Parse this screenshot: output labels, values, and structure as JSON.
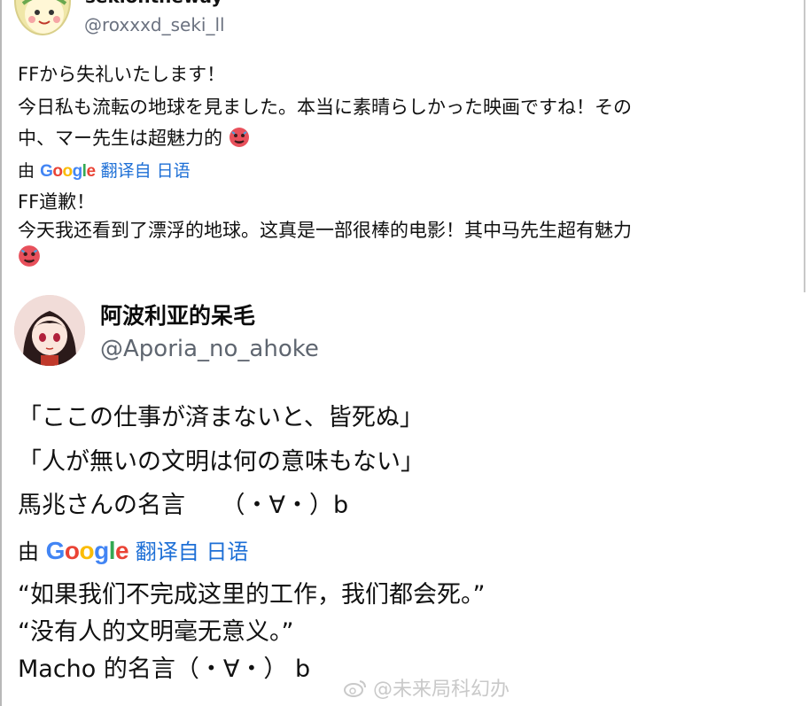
{
  "tweet1": {
    "display_name": "sekiontheway",
    "handle": "@roxxxd_seki_ll",
    "original_lines": [
      "FFから失礼いたします！",
      "今日私も流転の地球を見ました。本当に素晴らしかった映画ですね！その",
      "中、マー先生は超魅力的"
    ],
    "translate_by": "由",
    "translate_brand": "Google",
    "translate_link": "翻译自 日语",
    "translated_lines": [
      "FF道歉！",
      "今天我还看到了漂浮的地球。这真是一部很棒的电影！其中马先生超有魅力"
    ]
  },
  "tweet2": {
    "display_name": "阿波利亚的呆毛",
    "handle": "@Aporia_no_ahoke",
    "original_lines": [
      "「ここの仕事が済まないと、皆死ぬ」",
      "「人が無いの文明は何の意味もない」",
      "馬兆さんの名言　　（・∀・）b"
    ],
    "translate_by": "由",
    "translate_brand": "Google",
    "translate_link": "翻译自 日语",
    "translated_lines": [
      "“如果我们不完成这里的工作，我们都会死。”",
      "“没有人的文明毫无意义。”",
      "Macho 的名言（・∀・） b"
    ]
  },
  "watermark": "@未来局科幻办",
  "colors": {
    "link_blue": "#1d6fd6",
    "handle_gray": "#6b7280",
    "google_blue": "#4285F4",
    "google_red": "#EA4335",
    "google_yellow": "#FBBC05",
    "google_green": "#34A853"
  },
  "icons": [
    "hot-face-emoji-icon",
    "weibo-logo-icon"
  ]
}
